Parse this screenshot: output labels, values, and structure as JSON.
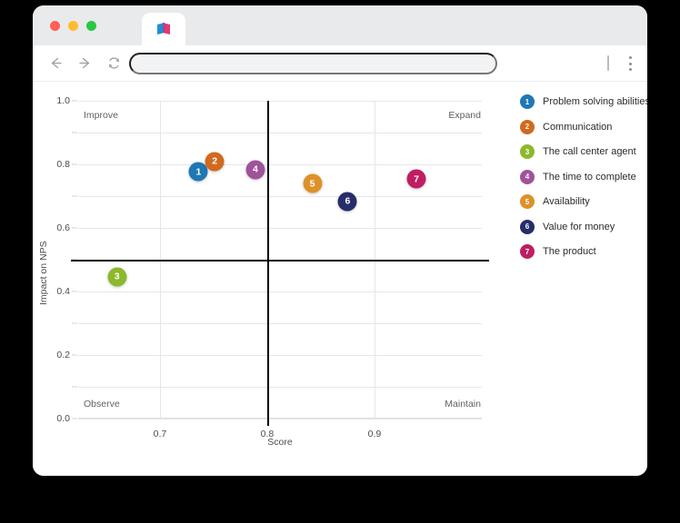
{
  "browser": {
    "traffic_lights": [
      "close",
      "minimize",
      "maximize"
    ],
    "tab": {
      "favicon": "flag-logo-icon",
      "title": ""
    },
    "toolbar": {
      "back_icon": "arrow-left-icon",
      "forward_icon": "arrow-right-icon",
      "reload_icon": "reload-icon",
      "address_value": "",
      "address_placeholder": "",
      "menu_icon": "three-dot-menu-icon"
    }
  },
  "chart_data": {
    "type": "scatter",
    "title": "",
    "xlabel": "Score",
    "ylabel": "Impact on NPS",
    "xlim": [
      0.6238,
      1.0
    ],
    "ylim": [
      0.0,
      1.0
    ],
    "xticks": [
      0.7,
      0.8,
      0.9
    ],
    "xtick_labels": [
      "0.7",
      "0.8",
      "0.9"
    ],
    "yticks": [
      0.0,
      0.2,
      0.4,
      0.6,
      0.8,
      1.0
    ],
    "ytick_labels": [
      "0.0",
      "0.2",
      "0.4",
      "0.6",
      "0.8",
      "1.0"
    ],
    "y_minor_ticks": [
      0.1,
      0.3,
      0.5,
      0.7,
      0.9
    ],
    "grid": true,
    "legend_position": "right",
    "quadrant_lines": {
      "x": 0.8,
      "y": 0.5
    },
    "quadrant_labels": {
      "top_left": "Improve",
      "top_right": "Expand",
      "bottom_left": "Observe",
      "bottom_right": "Maintain"
    },
    "points": [
      {
        "id": "1",
        "label": "Problem solving abilities",
        "x": 0.736,
        "y": 0.777,
        "color": "#1f77b4"
      },
      {
        "id": "2",
        "label": "Communication",
        "x": 0.751,
        "y": 0.809,
        "color": "#d2691e"
      },
      {
        "id": "3",
        "label": "The call center agent",
        "x": 0.66,
        "y": 0.446,
        "color": "#8cb92a"
      },
      {
        "id": "4",
        "label": "The time to complete",
        "x": 0.789,
        "y": 0.783,
        "color": "#a0539a"
      },
      {
        "id": "5",
        "label": "Availability",
        "x": 0.842,
        "y": 0.74,
        "color": "#dd9128"
      },
      {
        "id": "6",
        "label": "Value for money",
        "x": 0.875,
        "y": 0.683,
        "color": "#262d68"
      },
      {
        "id": "7",
        "label": "The product",
        "x": 0.939,
        "y": 0.754,
        "color": "#bf1e62"
      }
    ]
  }
}
